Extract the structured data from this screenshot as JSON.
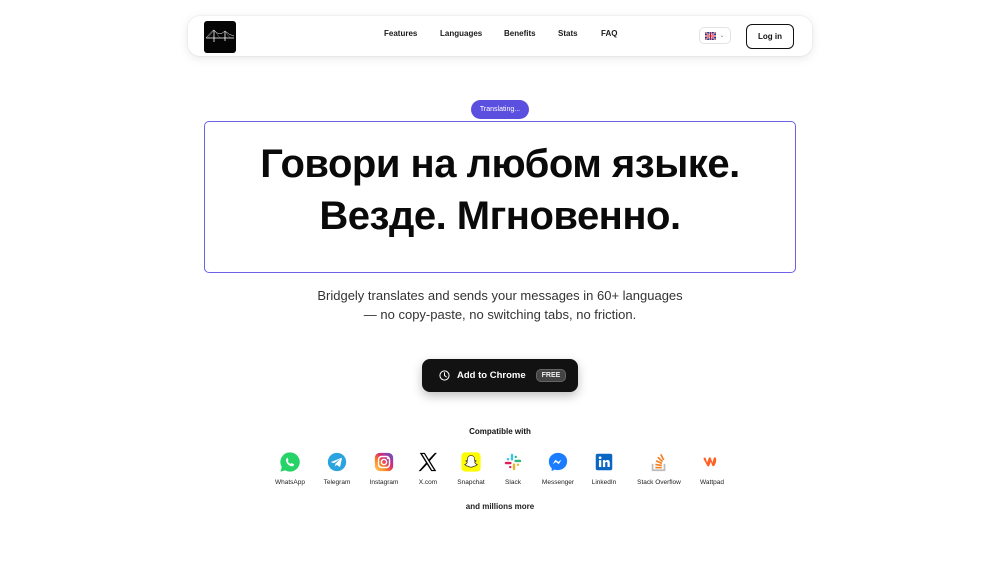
{
  "nav": {
    "links": [
      "Features",
      "Languages",
      "Benefits",
      "Stats",
      "FAQ"
    ],
    "language_flag": "gb-flag-icon",
    "login_label": "Log in"
  },
  "hero": {
    "pill": "Translating...",
    "headline_line1": "Говори на любом языке.",
    "headline_line2": "Везде. Мгновенно.",
    "subtitle_line1": "Bridgely translates and sends your messages in 60+ languages",
    "subtitle_line2": "— no copy-paste, no switching tabs, no friction.",
    "cta_label": "Add to Chrome",
    "cta_badge": "FREE"
  },
  "compatible": {
    "title": "Compatible with",
    "apps": [
      "WhatsApp",
      "Telegram",
      "Instagram",
      "X.com",
      "Snapchat",
      "Slack",
      "Messenger",
      "LinkedIn",
      "Stack Overflow",
      "Wattpad"
    ],
    "more": "and millions more"
  },
  "colors": {
    "accent": "#5b4fe0",
    "headline_border": "#6d62e6",
    "cta_bg": "#121212"
  }
}
